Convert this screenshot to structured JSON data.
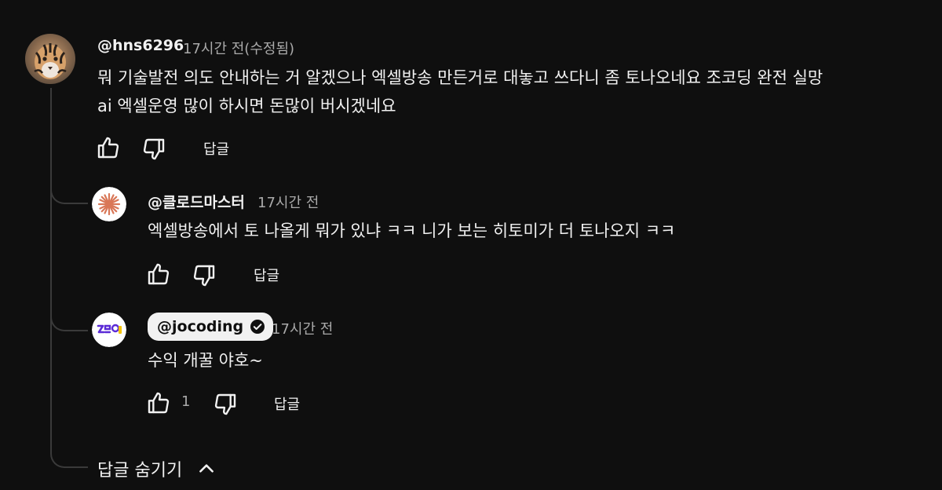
{
  "colors": {
    "background": "#0f0f0f",
    "text": "#f1f1f1",
    "muted": "#aaaaaa",
    "thread_line": "#3a3a3a",
    "badge_bg": "#f1f1f1"
  },
  "comment": {
    "author": "@hns6296",
    "time": "17시간 전(수정됨)",
    "lines": [
      "뭐 기술발전 의도 안내하는 거 알겠으나 엑셀방송 만든거로 대놓고 쓰다니 좀 토나오네요 조코딩 완전 실망",
      "ai 엑셀운영 많이 하시면 돈많이 버시겠네요"
    ],
    "reply_label": "답글",
    "avatar_icon": "tiger-avatar"
  },
  "replies": [
    {
      "author": "@클로드마스터",
      "time": "17시간 전",
      "text": "엑셀방송에서 토 나올게 뭐가 있냐 ㅋㅋ 니가 보는 히토미가 더 토나오지 ㅋㅋ",
      "reply_label": "답글",
      "avatar_icon": "claude-starburst-avatar"
    },
    {
      "author": "@jocoding",
      "verified": true,
      "time": "17시간 전",
      "text": "수익 개꿀 야호~",
      "like_count": "1",
      "reply_label": "답글",
      "avatar_icon": "jocoding-logo-avatar"
    }
  ],
  "hide_replies_label": "답글 숨기기"
}
